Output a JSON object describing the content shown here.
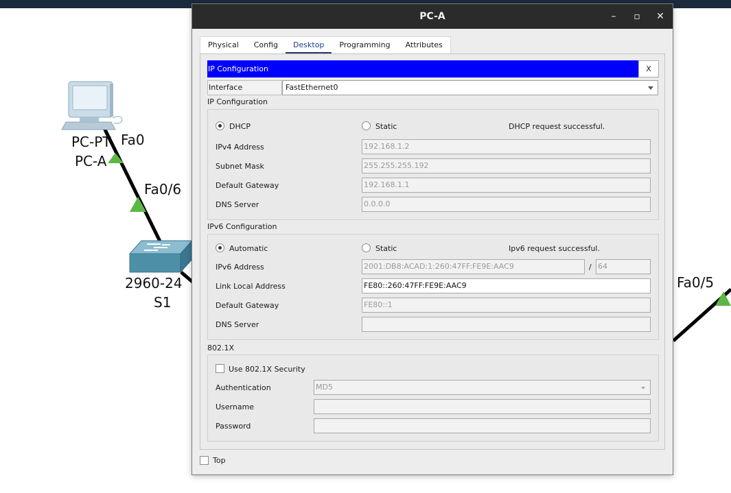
{
  "workspace": {
    "pc_labels": [
      "PC-PT",
      "PC-A"
    ],
    "pc_port": "Fa0",
    "switch_port": "Fa0/6",
    "switch_labels": [
      "2960-24",
      "S1"
    ],
    "right_port": "Fa0/5"
  },
  "window": {
    "title": "PC-A",
    "buttons": {
      "minimize": "–",
      "maximize": "▫",
      "close": "✕"
    }
  },
  "tabs": [
    {
      "label": "Physical",
      "active": false
    },
    {
      "label": "Config",
      "active": false
    },
    {
      "label": "Desktop",
      "active": true
    },
    {
      "label": "Programming",
      "active": false
    },
    {
      "label": "Attributes",
      "active": false
    }
  ],
  "ipconfig": {
    "header": "IP Configuration",
    "close_label": "X",
    "interface_label": "Interface",
    "interface_value": "FastEthernet0",
    "ipv4": {
      "title": "IP Configuration",
      "dhcp_label": "DHCP",
      "static_label": "Static",
      "mode": "DHCP",
      "status": "DHCP request successful.",
      "ipv4_address_label": "IPv4 Address",
      "ipv4_address": "192.168.1.2",
      "subnet_mask_label": "Subnet Mask",
      "subnet_mask": "255.255.255.192",
      "default_gateway_label": "Default Gateway",
      "default_gateway": "192.168.1.1",
      "dns_server_label": "DNS Server",
      "dns_server": "0.0.0.0"
    },
    "ipv6": {
      "title": "IPv6 Configuration",
      "automatic_label": "Automatic",
      "static_label": "Static",
      "mode": "Automatic",
      "status": "Ipv6 request successful.",
      "ipv6_address_label": "IPv6 Address",
      "ipv6_address": "2001:DB8:ACAD:1:260:47FF:FE9E:AAC9",
      "prefix_separator": "/",
      "prefix_length": "64",
      "link_local_label": "Link Local Address",
      "link_local": "FE80::260:47FF:FE9E:AAC9",
      "default_gateway_label": "Default Gateway",
      "default_gateway": "FE80::1",
      "dns_server_label": "DNS Server",
      "dns_server": ""
    },
    "dot1x": {
      "title": "802.1X",
      "use_security_label": "Use 802.1X Security",
      "use_security": false,
      "authentication_label": "Authentication",
      "authentication": "MD5",
      "username_label": "Username",
      "username": "",
      "password_label": "Password",
      "password": ""
    }
  },
  "footer": {
    "top_label": "Top",
    "top_checked": false
  },
  "colors": {
    "accent_bar": "#0000ff",
    "titlebar": "#2b2b2b",
    "link_green": "#5cb845",
    "switch_blue": "#4e8fa8",
    "active_tab_underline": "#1f3a68"
  }
}
